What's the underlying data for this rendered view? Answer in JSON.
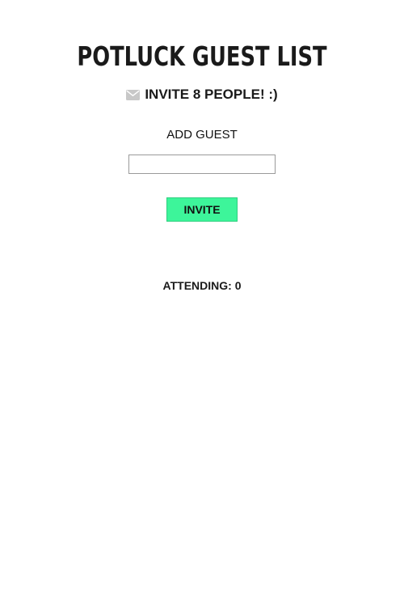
{
  "header": {
    "title": "POTLUCK GUEST LIST",
    "subtitle": "INVITE 8 PEOPLE! :)",
    "subtitle_icon": "envelope-icon"
  },
  "form": {
    "add_label": "ADD GUEST",
    "guest_input_value": "",
    "guest_input_placeholder": "",
    "invite_label": "INVITE"
  },
  "status": {
    "attending_text": "ATTENDING: 0"
  },
  "colors": {
    "invite_button": "#3df59a",
    "icon_gray": "#c8c8c8"
  }
}
